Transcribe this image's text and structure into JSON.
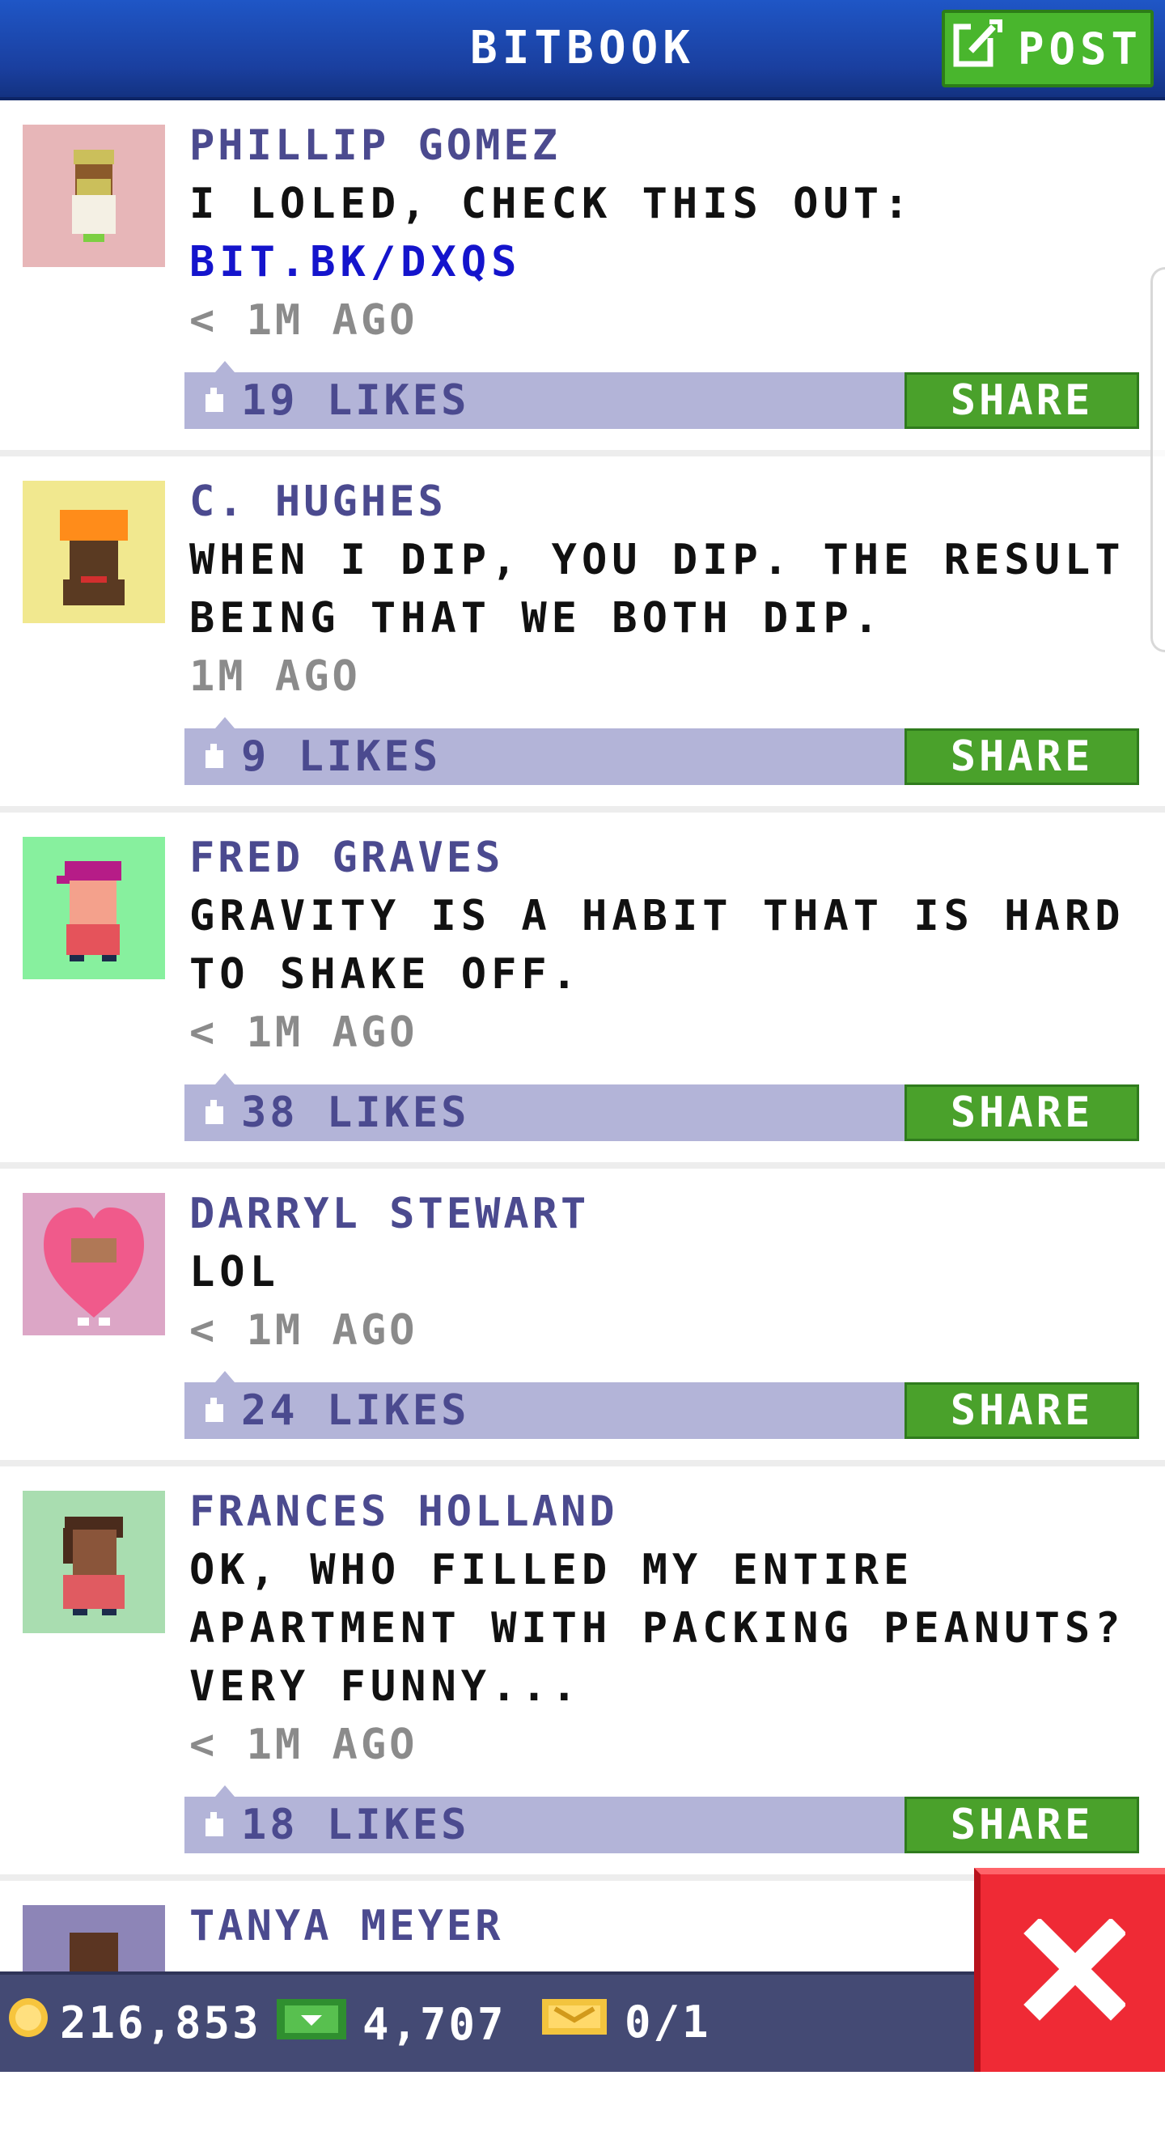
{
  "header": {
    "title": "BITBOOK",
    "post_label": "POST"
  },
  "feed": {
    "posts": [
      {
        "name": "PHILLIP GOMEZ",
        "text": "I LOLED, CHECK THIS OUT:",
        "link": "BIT.BK/DXQS",
        "time": "< 1M AGO",
        "likes": "19 LIKES",
        "share": "SHARE"
      },
      {
        "name": "C. HUGHES",
        "text": "WHEN I DIP, YOU DIP. THE RESULT BEING THAT WE BOTH DIP.",
        "time": "1M AGO",
        "likes": "9 LIKES",
        "share": "SHARE"
      },
      {
        "name": "FRED GRAVES",
        "text": "GRAVITY IS A HABIT THAT IS HARD TO SHAKE OFF.",
        "time": "< 1M AGO",
        "likes": "38 LIKES",
        "share": "SHARE"
      },
      {
        "name": "DARRYL STEWART",
        "text": "LOL",
        "time": "< 1M AGO",
        "likes": "24 LIKES",
        "share": "SHARE"
      },
      {
        "name": "FRANCES HOLLAND",
        "text": "OK, WHO FILLED MY ENTIRE APARTMENT WITH PACKING PEANUTS? VERY FUNNY...",
        "time": "< 1M AGO",
        "likes": "18 LIKES",
        "share": "SHARE"
      },
      {
        "name": "TANYA MEYER"
      }
    ]
  },
  "status_bar": {
    "coins": "216,853",
    "cash": "4,707",
    "tickets": "0/1"
  },
  "icons": {
    "post": "edit-icon",
    "like": "thumb-up-icon",
    "coin": "coin-icon",
    "cash": "cash-icon",
    "ticket": "ticket-icon",
    "close": "close-icon"
  },
  "colors": {
    "header_blue": "#1a3f9f",
    "green": "#4aa12b",
    "like_bar": "#b3b4d8",
    "name_text": "#4b4a8f",
    "link": "#1414cc",
    "close_red": "#ef2a35"
  }
}
